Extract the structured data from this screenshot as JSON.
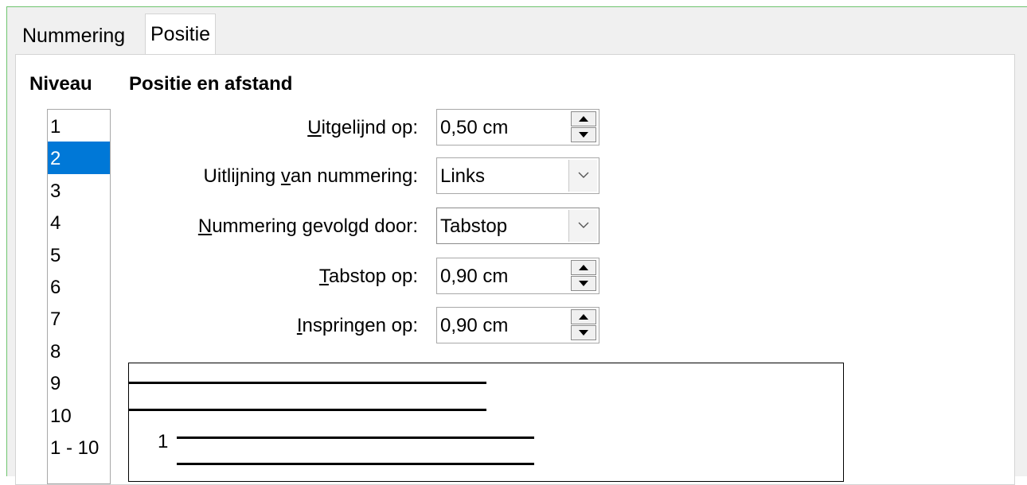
{
  "tabs": {
    "inactive_label": "Nummering",
    "active_label": "Positie"
  },
  "level": {
    "heading": "Niveau",
    "items": [
      "1",
      "2",
      "3",
      "4",
      "5",
      "6",
      "7",
      "8",
      "9",
      "10",
      "1 - 10"
    ],
    "selected": "2"
  },
  "position": {
    "heading": "Positie en afstand",
    "aligned_at": {
      "mnemonic": "U",
      "label_rest": "itgelijnd op:",
      "value": "0,50 cm",
      "icon": "spin-arrows-icon"
    },
    "numbering_alignment": {
      "label_before": "Uitlijning ",
      "mnemonic": "v",
      "label_after": "an nummering:",
      "value": "Links",
      "icon": "chevron-down-icon"
    },
    "numbering_followed_by": {
      "mnemonic": "N",
      "label_rest": "ummering gevolgd door:",
      "value": "Tabstop",
      "icon": "chevron-down-icon"
    },
    "tab_stop_at": {
      "mnemonic": "T",
      "label_rest": "abstop op:",
      "value": "0,90 cm",
      "icon": "spin-arrows-icon"
    },
    "indent_at": {
      "mnemonic": "I",
      "label_rest": "nspringen op:",
      "value": "0,90 cm",
      "icon": "spin-arrows-icon"
    }
  },
  "preview": {
    "number_label": "1"
  },
  "colors": {
    "selection": "#0078d7",
    "frame_border": "#6fc46f"
  }
}
